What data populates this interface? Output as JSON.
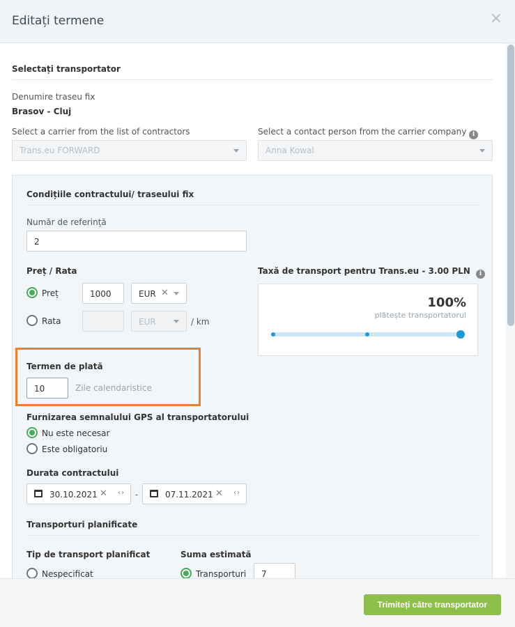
{
  "modal": {
    "title": "Editați termene",
    "close_glyph": "×"
  },
  "carrier_section": {
    "title": "Selectați transportator",
    "route_label": "Denumire traseu fix",
    "route_value": "Brasov - Cluj",
    "carrier_select_label": "Select a carrier from the list of contractors",
    "carrier_select_value": "Trans.eu FORWARD",
    "contact_select_label": "Select a contact person from the carrier company",
    "contact_select_value": "Anna Kowal"
  },
  "contract": {
    "title": "Condițiile contractului/ traseului fix",
    "reference_label": "Număr de referință",
    "reference_value": "2",
    "price_label": "Preț / Rata",
    "price_option_label": "Preț",
    "price_value": "1000",
    "price_currency": "EUR",
    "rate_option_label": "Rata",
    "rate_value": "",
    "rate_currency": "EUR",
    "rate_unit": "/ km",
    "fee_label": "Taxă de transport pentru Trans.eu - 3.00 PLN",
    "fee_percent": "100%",
    "fee_payer": "plătește transportatorul",
    "fee_share_fraction": 1.0,
    "payment_term_label": "Termen de plată",
    "payment_term_value": "10",
    "payment_term_unit": "Zile calendaristice",
    "gps_label": "Furnizarea semnalului GPS al transportatorului",
    "gps_option_not_required": "Nu este necesar",
    "gps_option_required": "Este obligatoriu",
    "duration_label": "Durata contractului",
    "date_from": "30.10.2021",
    "date_separator": "-",
    "date_to": "07.11.2021",
    "planned_title": "Transporturi planificate",
    "planned_type_label": "Tip de transport planificat",
    "planned_type_option": "Nespecificat",
    "estimated_label": "Suma estimată",
    "estimated_option": "Transporturi",
    "estimated_value": "7"
  },
  "footer": {
    "submit_label": "Trimiteți către transportator"
  },
  "colors": {
    "accent_green": "#46ad5c",
    "button_green": "#8dbf4a",
    "highlight_orange": "#ee7f2d",
    "slider_blue": "#1b9ad6"
  },
  "icons": {
    "info": "info-icon",
    "calendar": "calendar-icon",
    "close": "close-icon"
  }
}
